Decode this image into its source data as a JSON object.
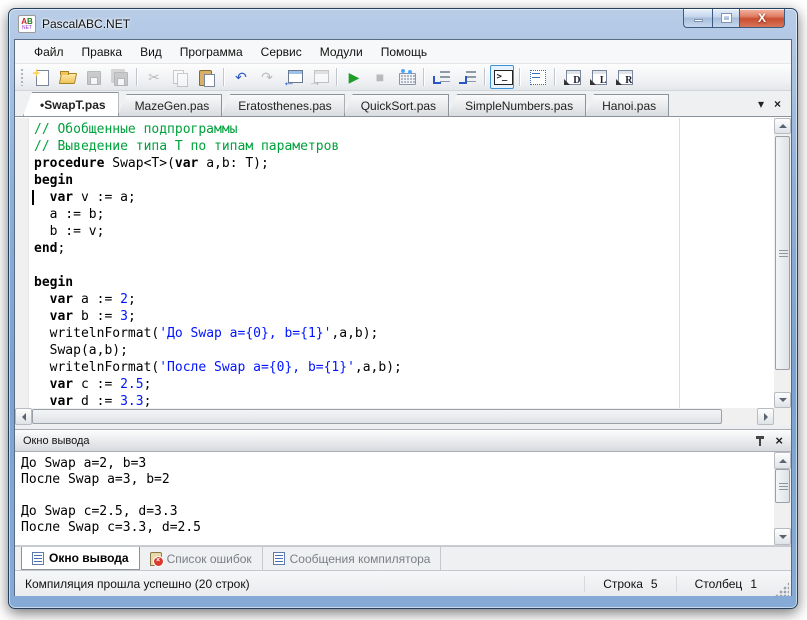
{
  "window": {
    "title": "PascalABC.NET"
  },
  "menu": {
    "items": [
      {
        "name": "file",
        "label": "Файл"
      },
      {
        "name": "edit",
        "label": "Правка"
      },
      {
        "name": "view",
        "label": "Вид"
      },
      {
        "name": "program",
        "label": "Программа"
      },
      {
        "name": "service",
        "label": "Сервис"
      },
      {
        "name": "modules",
        "label": "Модули"
      },
      {
        "name": "help",
        "label": "Помощь"
      }
    ]
  },
  "toolbar": {
    "items": [
      {
        "name": "new-file"
      },
      {
        "name": "open-file"
      },
      {
        "name": "save",
        "disabled": true
      },
      {
        "name": "save-all",
        "disabled": true
      },
      {
        "sep": true
      },
      {
        "name": "cut",
        "glyph": "✂",
        "disabled": true
      },
      {
        "name": "copy",
        "disabled": true
      },
      {
        "name": "paste"
      },
      {
        "sep": true
      },
      {
        "name": "undo",
        "glyph": "↶",
        "color": "#2a56c6"
      },
      {
        "name": "redo",
        "glyph": "↷",
        "disabled": true
      },
      {
        "name": "nav-back",
        "overlay": "←"
      },
      {
        "name": "nav-forward",
        "overlay": "→",
        "disabled": true
      },
      {
        "sep": true
      },
      {
        "name": "run",
        "glyph": "▶",
        "color": "#1e9e28"
      },
      {
        "name": "stop",
        "glyph": "■",
        "disabled": true
      },
      {
        "name": "keyboard"
      },
      {
        "sep": true
      },
      {
        "name": "indent"
      },
      {
        "name": "outdent"
      },
      {
        "sep": true
      },
      {
        "name": "console-window",
        "prompt": ">_",
        "active": true
      },
      {
        "sep": true
      },
      {
        "name": "form-designer"
      },
      {
        "sep": true
      },
      {
        "name": "template-d",
        "letter": "D"
      },
      {
        "name": "template-l",
        "letter": "L"
      },
      {
        "name": "template-r",
        "letter": "R"
      }
    ]
  },
  "tabs": {
    "items": [
      {
        "label": "•SwapT.pas",
        "active": true
      },
      {
        "label": "MazeGen.pas"
      },
      {
        "label": "Eratosthenes.pas"
      },
      {
        "label": "QuickSort.pas"
      },
      {
        "label": "SimpleNumbers.pas"
      },
      {
        "label": "Hanoi.pas"
      }
    ],
    "dropdown_glyph": "▾",
    "close_glyph": "×"
  },
  "editor": {
    "cursor_line": 5,
    "cursor_col": 1,
    "colors": {
      "comment": "#00a03c",
      "string_number": "#0014ff",
      "keyword": "#000000",
      "background": "#ffffff"
    },
    "lines": [
      [
        [
          "cm",
          "// Обобщенные подпрограммы"
        ]
      ],
      [
        [
          "cm",
          "// Выведение типа T по типам параметров"
        ]
      ],
      [
        [
          "kw",
          "procedure"
        ],
        [
          "pl",
          " Swap<T>("
        ],
        [
          "kw",
          "var"
        ],
        [
          "pl",
          " a,b: T);"
        ]
      ],
      [
        [
          "kw",
          "begin"
        ]
      ],
      [
        [
          "pl",
          "  "
        ],
        [
          "kw",
          "var"
        ],
        [
          "pl",
          " v := a;"
        ]
      ],
      [
        [
          "pl",
          "  a := b;"
        ]
      ],
      [
        [
          "pl",
          "  b := v;"
        ]
      ],
      [
        [
          "kw",
          "end"
        ],
        [
          "pl",
          ";"
        ]
      ],
      [],
      [
        [
          "kw",
          "begin"
        ]
      ],
      [
        [
          "pl",
          "  "
        ],
        [
          "kw",
          "var"
        ],
        [
          "pl",
          " a := "
        ],
        [
          "st",
          "2"
        ],
        [
          "pl",
          ";"
        ]
      ],
      [
        [
          "pl",
          "  "
        ],
        [
          "kw",
          "var"
        ],
        [
          "pl",
          " b := "
        ],
        [
          "st",
          "3"
        ],
        [
          "pl",
          ";"
        ]
      ],
      [
        [
          "pl",
          "  writelnFormat("
        ],
        [
          "st",
          "'До Swap a={0}, b={1}'"
        ],
        [
          "pl",
          ",a,b);"
        ]
      ],
      [
        [
          "pl",
          "  Swap(a,b);"
        ]
      ],
      [
        [
          "pl",
          "  writelnFormat("
        ],
        [
          "st",
          "'После Swap a={0}, b={1}'"
        ],
        [
          "pl",
          ",a,b);"
        ]
      ],
      [
        [
          "pl",
          "  "
        ],
        [
          "kw",
          "var"
        ],
        [
          "pl",
          " c := "
        ],
        [
          "st",
          "2.5"
        ],
        [
          "pl",
          ";"
        ]
      ],
      [
        [
          "pl",
          "  "
        ],
        [
          "kw",
          "var"
        ],
        [
          "pl",
          " d := "
        ],
        [
          "st",
          "3.3"
        ],
        [
          "pl",
          ";"
        ]
      ]
    ]
  },
  "output_panel": {
    "title": "Окно вывода",
    "close_glyph": "×",
    "lines": [
      "До Swap a=2, b=3",
      "После Swap a=3, b=2",
      "",
      "До Swap c=2.5, d=3.3",
      "После Swap c=3.3, d=2.5"
    ]
  },
  "bottom_tabs": {
    "items": [
      {
        "name": "output-window",
        "label": "Окно вывода",
        "icon": "doc",
        "active": true
      },
      {
        "name": "error-list",
        "label": "Список ошибок",
        "icon": "err"
      },
      {
        "name": "compiler-messages",
        "label": "Сообщения компилятора",
        "icon": "doc"
      }
    ]
  },
  "status_bar": {
    "message": "Компиляция прошла успешно (20 строк)",
    "line_label": "Строка",
    "line_value": "5",
    "col_label": "Столбец",
    "col_value": "1"
  },
  "colors": {
    "frame_blue": "#7ba2d0",
    "client_gray": "#f0f0f0",
    "close_red": "#c94f30",
    "toolbar_active_border": "#3a93d6"
  }
}
